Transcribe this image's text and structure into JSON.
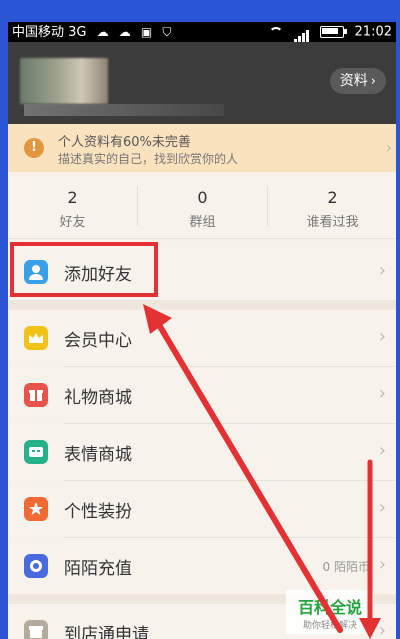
{
  "status_bar": {
    "carrier": "中国移动 3G",
    "time": "21:02",
    "icons": [
      "cloud-icon",
      "cloud-icon",
      "image-icon",
      "shield-icon",
      "wifi-icon",
      "signal-icon",
      "battery-icon"
    ]
  },
  "profile": {
    "profile_button_label": "资料",
    "profile_button_chevron": "›"
  },
  "banner": {
    "icon_text": "!",
    "title": "个人资料有60%未完善",
    "subtitle": "描述真实的自己，找到欣赏你的人"
  },
  "stats": [
    {
      "count": "2",
      "label": "好友"
    },
    {
      "count": "0",
      "label": "群组"
    },
    {
      "count": "2",
      "label": "谁看过我"
    }
  ],
  "menu": {
    "add_friend": {
      "label": "添加好友",
      "icon": "person-icon",
      "color": "#3aa0e6"
    },
    "items": [
      {
        "label": "会员中心",
        "icon": "crown-icon",
        "color": "#f2c21b"
      },
      {
        "label": "礼物商城",
        "icon": "gift-icon",
        "color": "#e8534c"
      },
      {
        "label": "表情商城",
        "icon": "emoji-icon",
        "color": "#25b28a"
      },
      {
        "label": "个性装扮",
        "icon": "star-icon",
        "color": "#ef6a34"
      },
      {
        "label": "陌陌充值",
        "icon": "coin-icon",
        "color": "#4a6be0",
        "value": "0 陌陌币"
      }
    ],
    "store_apply": {
      "label": "到店通申请",
      "icon": "store-icon",
      "color": "#b3aa9c"
    }
  },
  "chevron": "›",
  "watermark": {
    "title": "百科全说",
    "subtitle": "助你轻松解决"
  },
  "colors": {
    "highlight": "#e33134",
    "arrow": "#e33134"
  }
}
